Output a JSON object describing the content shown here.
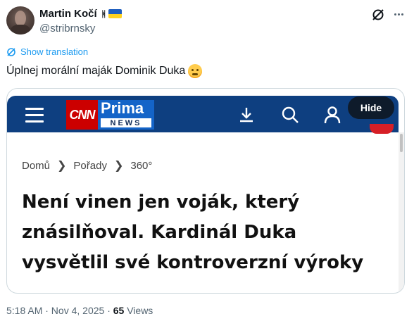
{
  "user": {
    "name": "Martin Kočí",
    "handle": "@stribrnsky",
    "name_symbol": "ᚻ"
  },
  "tweet": {
    "translation_label": "Show translation",
    "text": "Úplnej morální maják Dominik Duka",
    "emoji": "woozy-face"
  },
  "card": {
    "logo": {
      "cnn": "CNN",
      "prima": "Prima",
      "news": "NEWS"
    },
    "hide_label": "Hide",
    "breadcrumb": [
      "Domů",
      "Pořady",
      "360°"
    ],
    "headline_lines": [
      "Není vinen jen voják, který",
      "znásilňoval. Kardinál Duka",
      "vysvětlil své kontroverzní výroky"
    ]
  },
  "meta": {
    "time_date": "5:18 AM · Nov 4, 2025 · ",
    "views": "65",
    "views_label": " Views"
  },
  "colors": {
    "accent": "#1d9bf0",
    "nav": "#0e3f80",
    "cnn_red": "#cc0000",
    "prima_blue": "#1464c8"
  }
}
